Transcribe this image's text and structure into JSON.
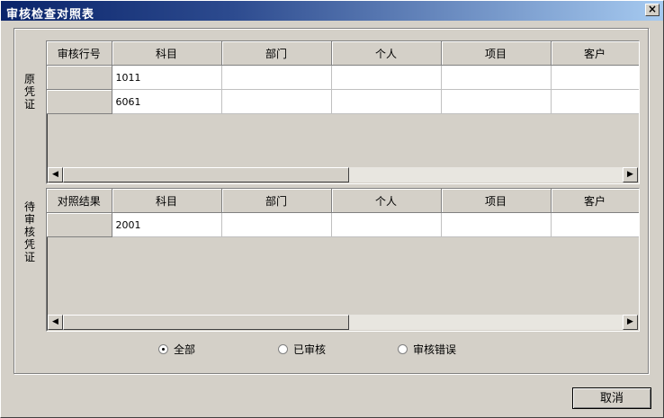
{
  "window": {
    "title": "审核检查对照表",
    "close_glyph": "×"
  },
  "original_voucher": {
    "label": "原凭证",
    "columns": [
      "审核行号",
      "科目",
      "部门",
      "个人",
      "项目",
      "客户"
    ],
    "rows": [
      [
        "",
        "1011",
        "",
        "",
        "",
        ""
      ],
      [
        "",
        "6061",
        "",
        "",
        "",
        ""
      ]
    ]
  },
  "pending_voucher": {
    "label": "待审核凭证",
    "columns": [
      "对照结果",
      "科目",
      "部门",
      "个人",
      "项目",
      "客户"
    ],
    "rows": [
      [
        "",
        "2001",
        "",
        "",
        "",
        ""
      ]
    ]
  },
  "scroll": {
    "left_glyph": "◀",
    "right_glyph": "▶"
  },
  "filter": {
    "options": [
      "全部",
      "已审核",
      "审核错误"
    ],
    "selected": "全部"
  },
  "buttons": {
    "cancel": "取消"
  }
}
